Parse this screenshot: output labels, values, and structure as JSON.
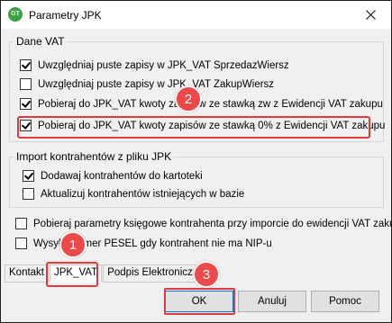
{
  "window": {
    "title": "Parametry JPK",
    "app_icon_text": "GT"
  },
  "group_vat": {
    "legend": "Dane VAT",
    "options": [
      {
        "label": "Uwzględniaj puste zapisy w JPK_VAT SprzedazWiersz",
        "checked": true
      },
      {
        "label": "Uwzględniaj puste zapisy w JPK_VAT ZakupWiersz",
        "checked": false
      },
      {
        "label": "Pobieraj do JPK_VAT kwoty zapisów ze stawką zw z Ewidencji VAT zakupu",
        "checked": true
      },
      {
        "label": "Pobieraj do JPK_VAT kwoty zapisów ze stawką 0% z Ewidencji VAT zakupu",
        "checked": true
      }
    ]
  },
  "group_import": {
    "legend": "Import kontrahentów z pliku JPK",
    "options": [
      {
        "label": "Dodawaj kontrahentów do kartoteki",
        "checked": true
      },
      {
        "label": "Aktualizuj kontrahentów istniejących w bazie",
        "checked": false
      }
    ]
  },
  "extra_options": [
    {
      "label": "Pobieraj parametry księgowe kontrahenta przy imporcie do ewidencji VAT zakupu",
      "checked": false
    },
    {
      "label": "Wysyłaj numer PESEL gdy kontrahent nie ma NIP-u",
      "checked": false
    }
  ],
  "tabs": [
    {
      "label": "Kontakt",
      "active": false
    },
    {
      "label": "JPK_VAT",
      "active": true
    },
    {
      "label": "Podpis Elektroniczny",
      "active": false
    }
  ],
  "buttons": {
    "ok": "OK",
    "cancel": "Anuluj",
    "help": "Pomoc"
  },
  "markers": [
    "1",
    "2",
    "3"
  ],
  "colors": {
    "annotation_red": "#e03a3a",
    "marker_fill": "#ec4a4a"
  }
}
